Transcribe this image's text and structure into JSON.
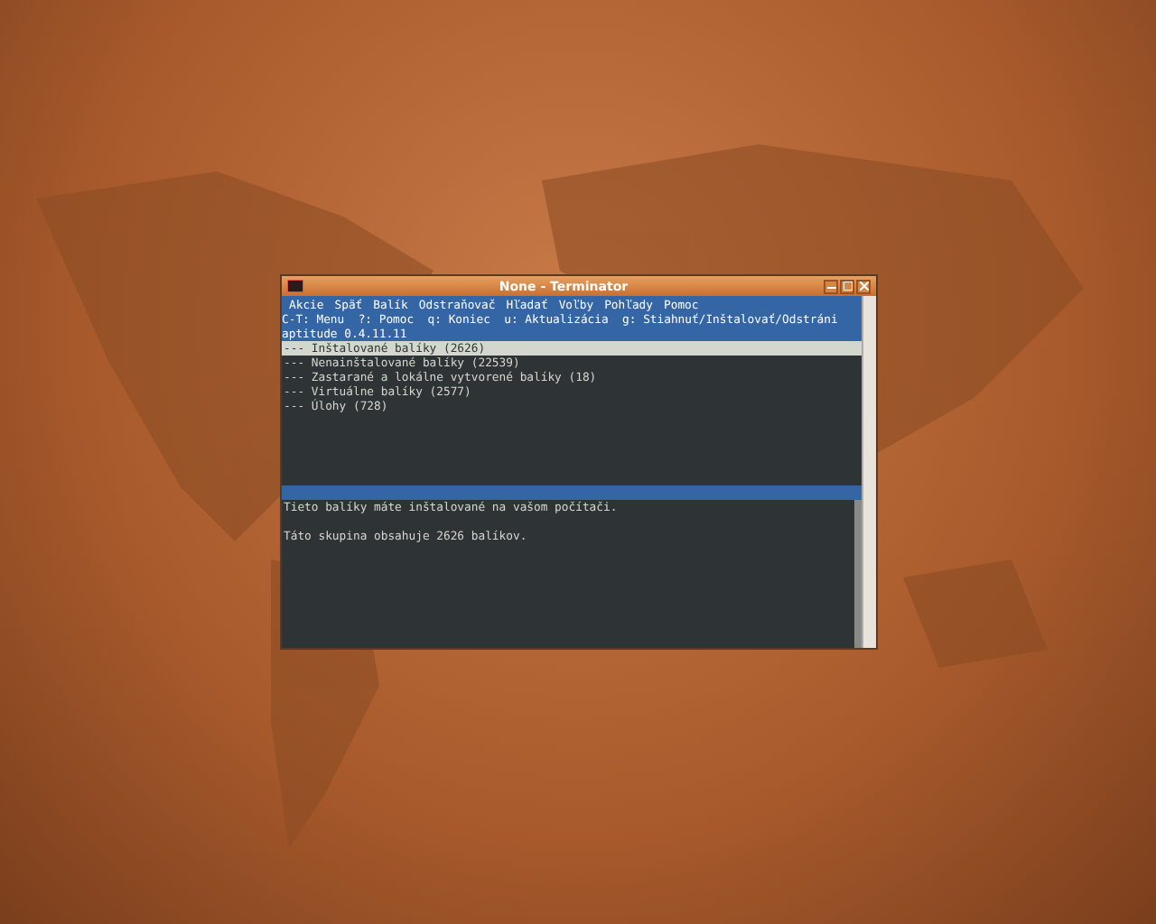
{
  "window": {
    "title": "None - Terminator"
  },
  "menu": [
    "Akcie",
    "Späť",
    "Balík",
    "Odstraňovač",
    "Hľadať",
    "Voľby",
    "Pohľady",
    "Pomoc"
  ],
  "key_hints": "C-T: Menu  ?: Pomoc  q: Koniec  u: Aktualizácia  g: Stiahnuť/Inštalovať/Odstráni",
  "version": "aptitude 0.4.11.11",
  "package_groups": [
    {
      "prefix": "---",
      "label": "Inštalované balíky (2626)",
      "selected": true
    },
    {
      "prefix": "---",
      "label": "Nenainštalované balíky (22539)",
      "selected": false
    },
    {
      "prefix": "---",
      "label": "Zastarané a lokálne vytvorené balíky (18)",
      "selected": false
    },
    {
      "prefix": "---",
      "label": "Virtuálne balíky (2577)",
      "selected": false
    },
    {
      "prefix": "---",
      "label": "Úlohy (728)",
      "selected": false
    }
  ],
  "description": [
    "Tieto balíky máte inštalované na vašom počítači.",
    "Táto skupina obsahuje 2626 balíkov."
  ]
}
